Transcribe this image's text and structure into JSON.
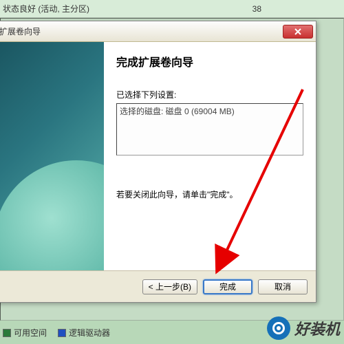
{
  "background": {
    "status_text": "状态良好 (活动, 主分区)",
    "number": "38"
  },
  "legend": {
    "available": "可用空间",
    "logical": "逻辑驱动器"
  },
  "wizard": {
    "title": "扩展卷向导",
    "heading": "完成扩展卷向导",
    "settings_label": "已选择下列设置:",
    "settings_content": "选择的磁盘: 磁盘 0 (69004 MB)",
    "instruction": "若要关闭此向导，请单击\"完成\"。",
    "buttons": {
      "back": "< 上一步(B)",
      "finish": "完成",
      "cancel": "取消"
    }
  },
  "watermark": {
    "text": "好装机"
  }
}
